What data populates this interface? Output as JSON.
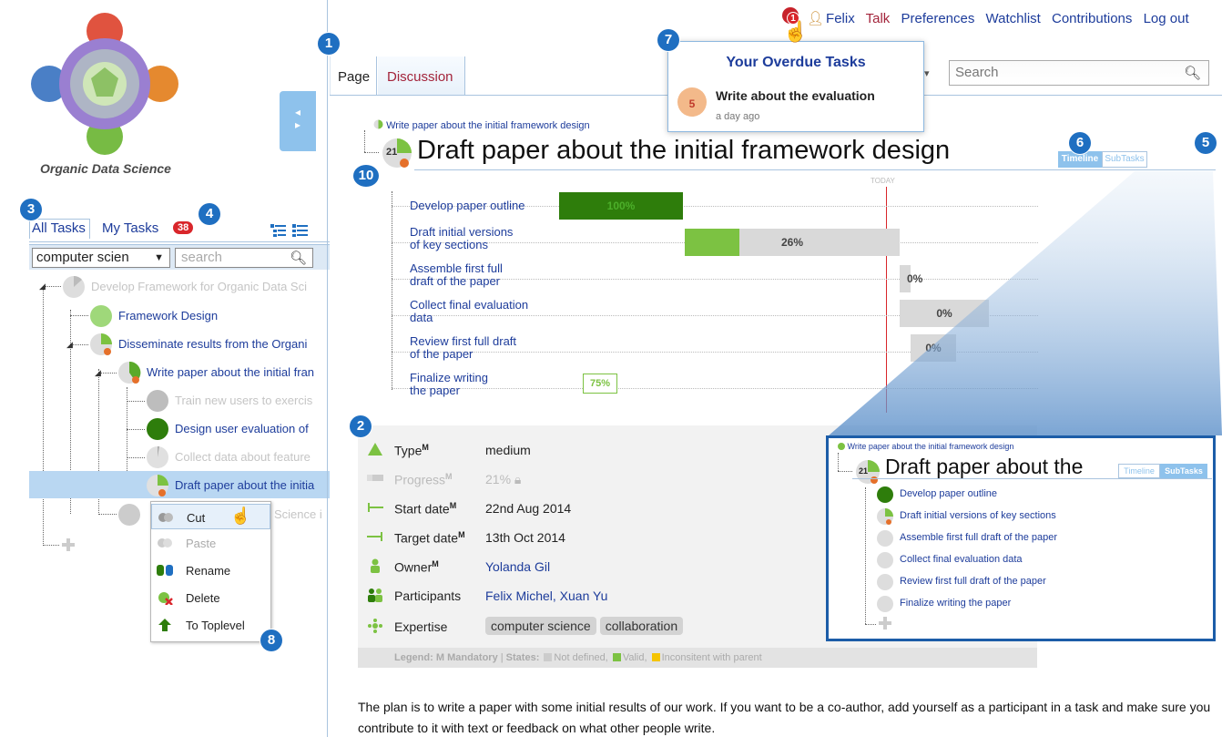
{
  "sidebar": {
    "logo_text": "Organic Data Science",
    "tabs": {
      "all": "All Tasks",
      "my": "My Tasks",
      "my_count": "38"
    },
    "filter": {
      "category": "computer scien",
      "search_placeholder": "search"
    },
    "tree": [
      {
        "label": "Develop Framework for Organic Data Sci",
        "state": "muted"
      },
      {
        "label": "Framework Design",
        "state": "link"
      },
      {
        "label": "Disseminate results from the Organi",
        "state": "link"
      },
      {
        "label": "Write paper about the initial fran",
        "state": "link"
      },
      {
        "label": "Train new users to exercis",
        "state": "muted"
      },
      {
        "label": "Design user evaluation of",
        "state": "link"
      },
      {
        "label": "Collect data about feature",
        "state": "muted"
      },
      {
        "label": "Draft paper about the initia",
        "state": "link"
      },
      {
        "label": "Science i",
        "state": "muted"
      }
    ],
    "context_menu": [
      "Cut",
      "Paste",
      "Rename",
      "Delete",
      "To Toplevel"
    ]
  },
  "header": {
    "notification_count": "1",
    "user": "Felix",
    "links": [
      "Talk",
      "Preferences",
      "Watchlist",
      "Contributions",
      "Log out"
    ],
    "search_placeholder": "Search",
    "tabs": {
      "page": "Page",
      "discussion": "Discussion"
    }
  },
  "overdue": {
    "title": "Your Overdue Tasks",
    "task": "Write about the evaluation",
    "days": "5",
    "time": "a day ago"
  },
  "task": {
    "breadcrumb": "Write paper about the initial framework design",
    "title": "Draft paper about the initial framework design",
    "title_count": "21",
    "view_timeline": "Timeline",
    "view_subtasks": "SubTasks",
    "today_label": "TODAY"
  },
  "gantt": {
    "rows": [
      {
        "label1": "Develop paper outline",
        "label2": "",
        "progress": 100,
        "pct": "100%"
      },
      {
        "label1": "Draft initial versions",
        "label2": "of key sections",
        "progress": 26,
        "pct": "26%"
      },
      {
        "label1": "Assemble first full",
        "label2": "draft of the paper",
        "progress": 0,
        "pct": "0%"
      },
      {
        "label1": "Collect final evaluation",
        "label2": "data",
        "progress": 0,
        "pct": "0%"
      },
      {
        "label1": "Review first full draft",
        "label2": "of the paper",
        "progress": 0,
        "pct": "0%"
      },
      {
        "label1": "Finalize writing",
        "label2": "the paper",
        "progress": 75,
        "pct": "75%"
      }
    ]
  },
  "info": {
    "rows": [
      {
        "key": "Type",
        "mandatory": "M",
        "value": "medium"
      },
      {
        "key": "Progress",
        "mandatory": "M",
        "value": "21%"
      },
      {
        "key": "Start date",
        "mandatory": "M",
        "value": "22nd Aug 2014"
      },
      {
        "key": "Target date",
        "mandatory": "M",
        "value": "13th Oct 2014"
      },
      {
        "key": "Owner",
        "mandatory": "M",
        "value": "Yolanda Gil"
      },
      {
        "key": "Participants",
        "mandatory": "",
        "value": "Felix Michel, Xuan Yu"
      },
      {
        "key": "Expertise",
        "mandatory": "",
        "value": ""
      }
    ],
    "expertise": [
      "computer science",
      "collaboration"
    ],
    "legend": {
      "label": "Legend:",
      "mandatory": "M Mandatory",
      "states": "States:",
      "not_defined": "Not defined,",
      "valid": "Valid,",
      "inconsistent": "Inconsitent with parent"
    }
  },
  "description": "The plan is to write a paper with some initial results of our work. If you want to be a co-author, add yourself as a participant in a task and make sure you contribute to it with text or feedback on what other people write.",
  "inset": {
    "breadcrumb": "Write paper about the initial framework design",
    "title": "Draft paper about the",
    "count": "21",
    "toggle_timeline": "Timeline",
    "toggle_subtasks": "SubTasks",
    "items": [
      "Develop paper outline",
      "Draft initial versions of key sections",
      "Assemble first full draft of the paper",
      "Collect final evaluation data",
      "Review first full draft of the paper",
      "Finalize writing the paper"
    ]
  },
  "callouts": [
    "1",
    "2",
    "3",
    "4",
    "5",
    "6",
    "7",
    "8",
    "10"
  ],
  "colors": {
    "accent_blue": "#1f6fc1",
    "link": "#1d3c9b",
    "green_dark": "#2e7d0b",
    "green_light": "#7cc242",
    "red": "#d9262b",
    "today_line": "#d9262b"
  }
}
